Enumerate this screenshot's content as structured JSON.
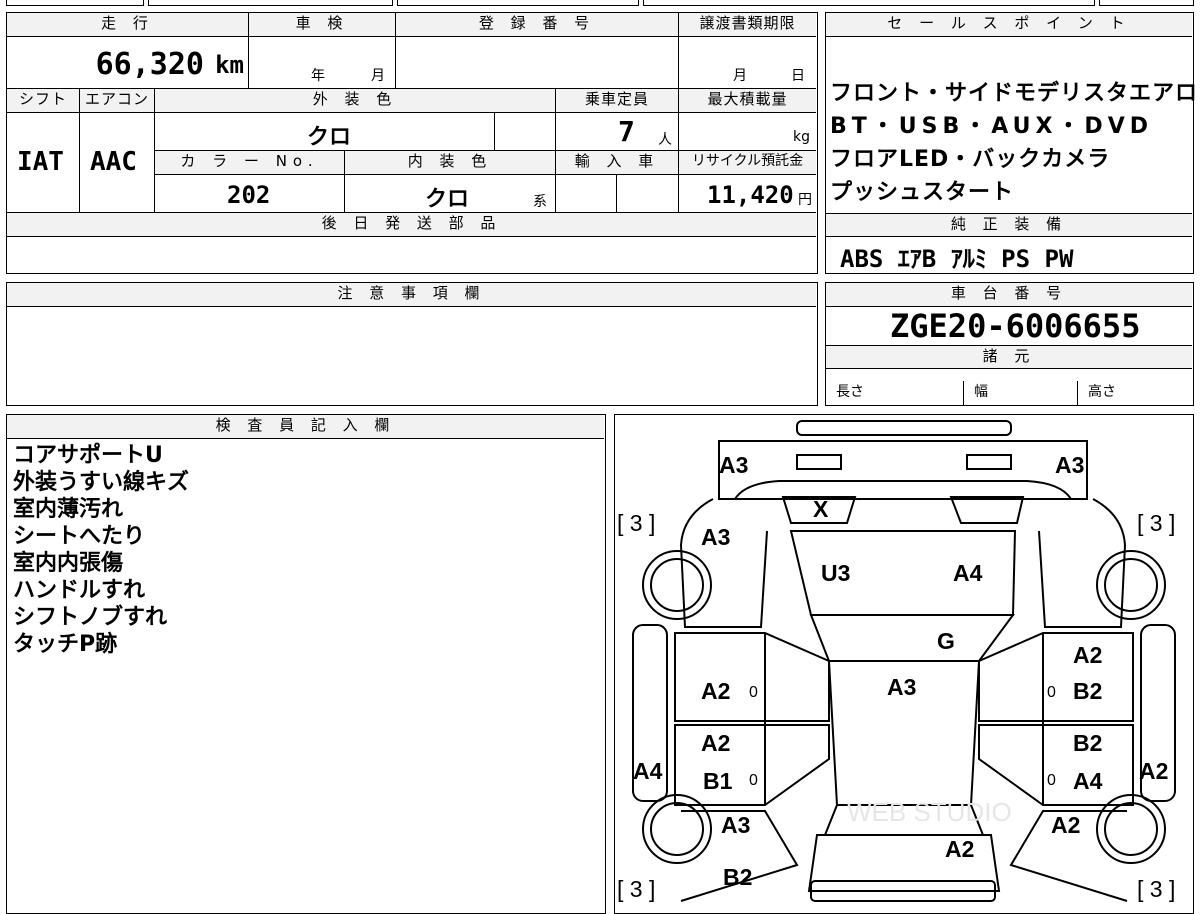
{
  "top_row": {
    "values": [
      "",
      "",
      "",
      "",
      ""
    ]
  },
  "mileage": {
    "label": "走 行",
    "value": "66,320",
    "unit": "km"
  },
  "inspection": {
    "label": "車 検",
    "year": "年",
    "month": "月"
  },
  "registration": {
    "label": "登 録 番 号",
    "value": ""
  },
  "transfer_deadline": {
    "label": "譲渡書類期限",
    "month": "月",
    "day": "日"
  },
  "shift": {
    "label": "シフト",
    "value": "IAT"
  },
  "aircon": {
    "label": "エアコン",
    "value": "AAC"
  },
  "exterior_color": {
    "label": "外 装 色",
    "value": "クロ"
  },
  "capacity": {
    "label": "乗車定員",
    "value": "7",
    "unit": "人"
  },
  "max_load": {
    "label": "最大積載量",
    "value": "",
    "unit": "kg"
  },
  "color_no": {
    "label": "カ ラ ー No.",
    "value": "202"
  },
  "interior_color": {
    "label": "内 装 色",
    "value": "クロ",
    "suffix": "系"
  },
  "import": {
    "label": "輸 入 車",
    "value": ""
  },
  "recycle": {
    "label": "リサイクル預託金",
    "value": "11,420",
    "unit": "円"
  },
  "later_parts": {
    "label": "後 日 発 送 部 品",
    "value": ""
  },
  "sales_points": {
    "label": "セ ー ル ス ポ イ ン ト",
    "lines": [
      "フロント・サイドモデリスタエアロ",
      "BT・USB・AUX・DVD",
      "フロアLED・バックカメラ",
      "プッシュスタート"
    ]
  },
  "equipment": {
    "label": "純 正 装 備",
    "items": "ABS ｴｱB ｱﾙﾐ PS PW"
  },
  "notes": {
    "label": "注 意 事 項 欄",
    "value": ""
  },
  "chassis": {
    "label": "車 台 番 号",
    "value": "ZGE20-6006655"
  },
  "specs": {
    "label": "諸 元",
    "length": "長さ",
    "width": "幅",
    "height": "高さ"
  },
  "inspector": {
    "label": "検 査 員 記 入 欄",
    "lines": [
      "コアサポートU",
      "外装うすい線キズ",
      "室内薄汚れ",
      "シートへたり",
      "室内内張傷",
      "ハンドルすれ",
      "シフトノブすれ",
      "タッチP跡"
    ]
  },
  "diagram": {
    "marks": {
      "front_left": "A3",
      "front_right": "A3",
      "tire_fl": "[ 3 ]",
      "tire_fr": "[ 3 ]",
      "tire_rl": "[ 3 ]",
      "tire_rr": "[ 3 ]",
      "fender_left": "A3",
      "grille": "X",
      "hood_left": "U3",
      "hood_right": "A4",
      "windshield": "G",
      "roof": "A3",
      "front_door_left": "A2",
      "front_door_right_top": "A2",
      "front_door_right": "B2",
      "rear_door_left_top": "A2",
      "rear_door_left": "B1",
      "rear_door_right_top": "B2",
      "rear_door_right": "A4",
      "sill_left": "A4",
      "sill_right": "A2",
      "quarter_left": "A3",
      "quarter_right": "A2",
      "trunk": "A2",
      "rear_bumper": "B2",
      "handle_fl": "0",
      "handle_fr": "0",
      "handle_rl": "0",
      "handle_rr": "0"
    },
    "watermark": "WEB STUDIO"
  }
}
